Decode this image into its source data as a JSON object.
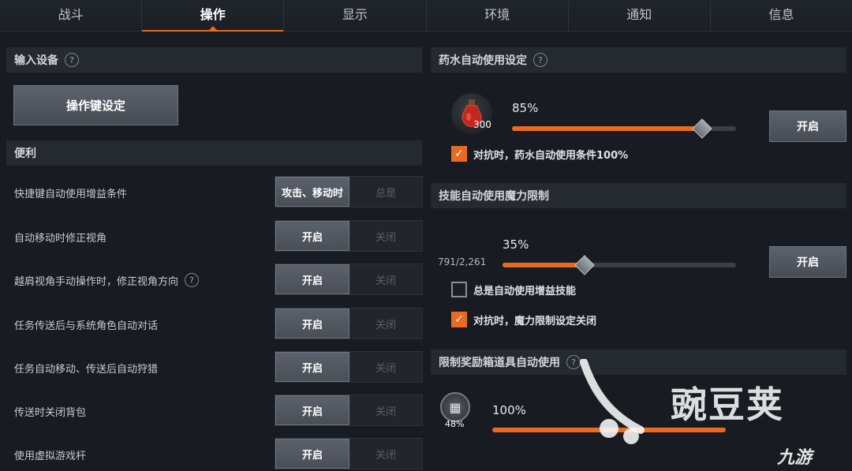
{
  "tabs": [
    {
      "label": "战斗",
      "active": false
    },
    {
      "label": "操作",
      "active": true
    },
    {
      "label": "显示",
      "active": false
    },
    {
      "label": "环境",
      "active": false
    },
    {
      "label": "通知",
      "active": false
    },
    {
      "label": "信息",
      "active": false
    }
  ],
  "input_device": {
    "title": "输入设备",
    "help": "?",
    "keybind_button": "操作键设定"
  },
  "convenience": {
    "title": "便利",
    "rows": [
      {
        "label": "快捷键自动使用增益条件",
        "on": "攻击、移动时",
        "off": "总是",
        "help": ""
      },
      {
        "label": "自动移动时修正视角",
        "on": "开启",
        "off": "关闭",
        "help": ""
      },
      {
        "label": "越肩视角手动操作时，修正视角方向",
        "on": "开启",
        "off": "关闭",
        "help": "?"
      },
      {
        "label": "任务传送后与系统角色自动对话",
        "on": "开启",
        "off": "关闭",
        "help": ""
      },
      {
        "label": "任务自动移动、传送后自动狩猎",
        "on": "开启",
        "off": "关闭",
        "help": ""
      },
      {
        "label": "传送时关闭背包",
        "on": "开启",
        "off": "关闭",
        "help": ""
      },
      {
        "label": "使用虚拟游戏杆",
        "on": "开启",
        "off": "关闭",
        "help": ""
      }
    ]
  },
  "potion": {
    "title": "药水自动使用设定",
    "help": "?",
    "count": "300",
    "percent_label": "85%",
    "percent": 0.85,
    "button": "开启",
    "checkbox_label": "对抗时，药水自动使用条件100%",
    "checked": true
  },
  "skill": {
    "title": "技能自动使用魔力限制",
    "mana": "791/2,261",
    "percent_label": "35%",
    "percent": 0.35,
    "button": "开启",
    "checkbox1_label": "总是自动使用增益技能",
    "checkbox1_checked": false,
    "checkbox2_label": "对抗时，魔力限制设定关闭",
    "checkbox2_checked": true
  },
  "reward": {
    "title": "限制奖励箱道具自动使用",
    "help": "?",
    "badge": "48%",
    "percent_label": "100%",
    "percent": 1.0
  },
  "watermarks": {
    "wm1": "豌豆荚",
    "wm2": "九游"
  },
  "colors": {
    "accent": "#ea6a20",
    "background": "#181c22",
    "section_header": "#252a31"
  }
}
